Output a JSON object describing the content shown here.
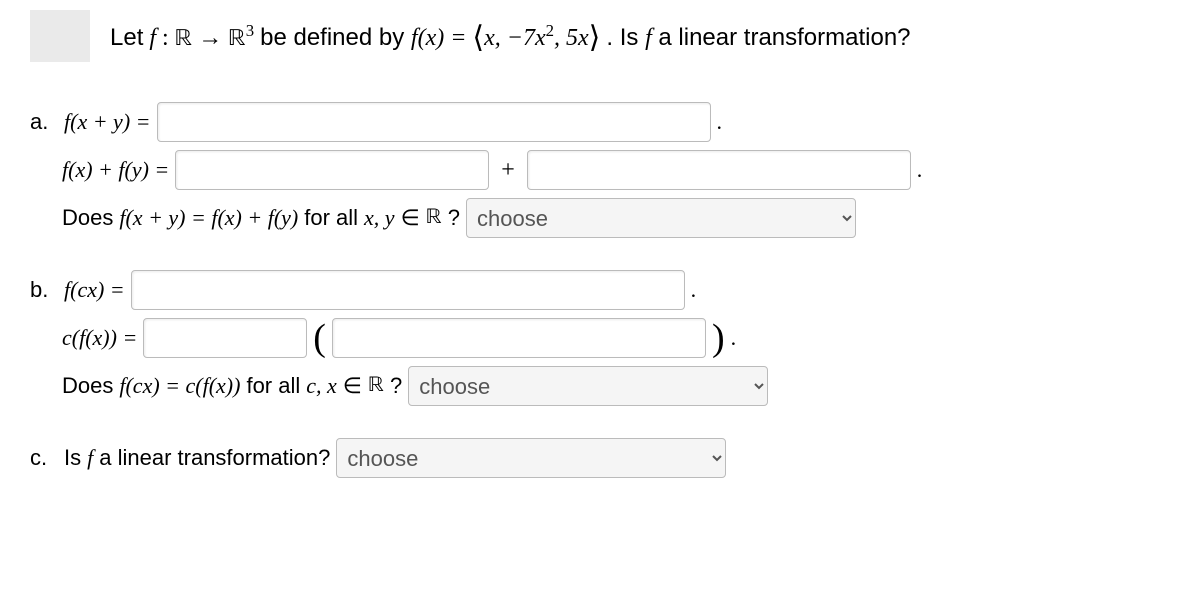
{
  "header": {
    "prefix": "Let",
    "func_decl_1": "f",
    "func_decl_2": " : ",
    "dom": "ℝ",
    "arrow": " → ",
    "codom": "ℝ",
    "codom_sup": "3",
    "mid": " be defined by ",
    "fx": "f(x) = ",
    "lang": "⟨",
    "tuple": "x, −7x",
    "tuple_sup": "2",
    "tuple2": ", 5x",
    "rang": "⟩",
    "tail": ". Is ",
    "tail_f": "f",
    "tail2": " a linear transformation?"
  },
  "a": {
    "label": "a.",
    "line1_lhs": "f(x + y) =",
    "period1": ".",
    "line2_lhs": "f(x) + f(y) =",
    "plus": "+",
    "period2": ".",
    "line3_pre": "Does ",
    "line3_eq": "f(x + y) = f(x) + f(y)",
    "line3_mid": " for all ",
    "line3_xy": "x, y",
    "line3_in": " ∈ ",
    "line3_R": "ℝ",
    "line3_q": "?"
  },
  "b": {
    "label": "b.",
    "line1_lhs": "f(cx) =",
    "period1": ".",
    "line2_lhs": "c(f(x)) =",
    "lparen": "(",
    "rparen": ")",
    "period2": ".",
    "line3_pre": "Does ",
    "line3_eq": "f(cx) = c(f(x))",
    "line3_mid": " for all ",
    "line3_cx": "c, x",
    "line3_in": " ∈ ",
    "line3_R": "ℝ",
    "line3_q": "?"
  },
  "c": {
    "label": "c.",
    "text_pre": "Is ",
    "text_f": "f",
    "text_post": " a linear transformation?"
  },
  "dropdown": {
    "placeholder": "choose"
  }
}
